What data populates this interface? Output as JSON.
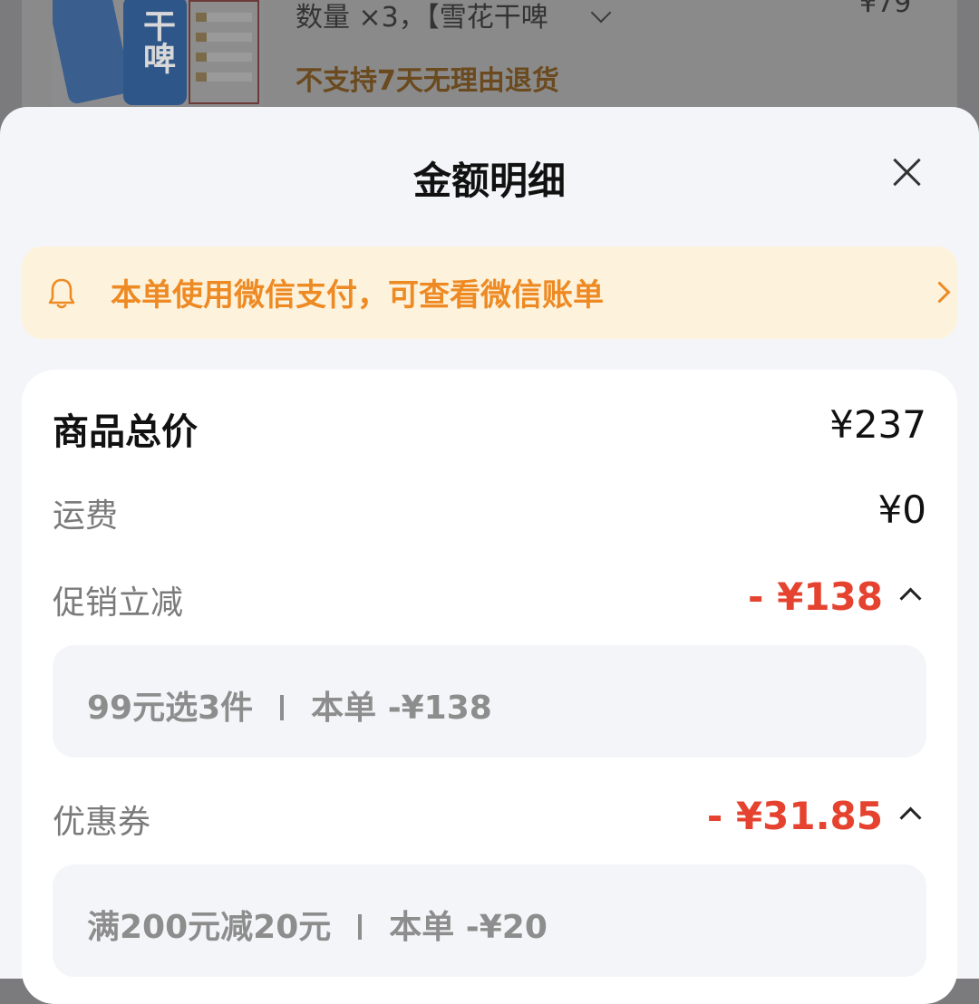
{
  "background_order": {
    "thumb_can_label": "干啤",
    "quantity_text": "数量 ×3，【雪花干啤",
    "price_text": "¥79",
    "return_note": "不支持7天无理由退货"
  },
  "sheet": {
    "title": "金额明细",
    "notice": {
      "text": "本单使用微信支付，可查看微信账单",
      "icon": "bell-icon",
      "color": "#ee8a23"
    },
    "rows": {
      "goods_total": {
        "label": "商品总价",
        "amount": "¥237"
      },
      "shipping": {
        "label": "运费",
        "amount": "¥0"
      },
      "promotion": {
        "label": "促销立减",
        "amount": "- ¥138",
        "detail_name": "99元选3件",
        "detail_value": "本单 -¥138"
      },
      "coupon": {
        "label": "优惠券",
        "amount": "- ¥31.85",
        "detail_name": "满200元减20元",
        "detail_value": "本单 -¥20"
      }
    },
    "accent_red": "#e5432f"
  }
}
